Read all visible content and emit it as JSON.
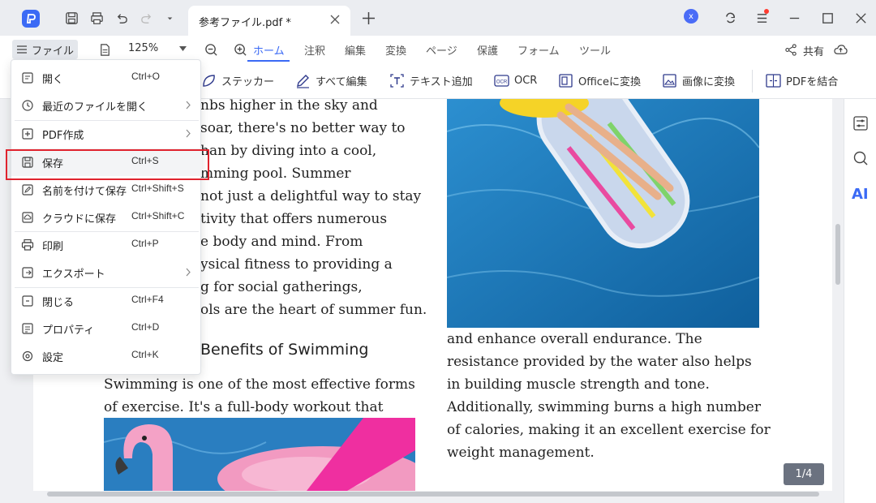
{
  "titlebar": {
    "tab_title": "参考ファイル.pdf *",
    "avatar_initial": "x"
  },
  "menubar": {
    "file_menu_label": "ファイル",
    "zoom": "125%",
    "tabs": [
      "ホーム",
      "注釈",
      "編集",
      "変換",
      "ページ",
      "保護",
      "フォーム",
      "ツール"
    ],
    "active_tab": "ホーム",
    "share_label": "共有"
  },
  "ribbon": {
    "items": [
      "ステッカー",
      "すべて編集",
      "テキスト追加",
      "OCR",
      "Officeに変換",
      "画像に変換",
      "PDFを結合"
    ]
  },
  "document": {
    "left_column_lines": [
      "nbs higher in the sky and",
      "soar, there's no better way to",
      "han by diving into a cool,",
      "mming pool. Summer",
      "not just a delightful way to stay",
      "tivity that offers numerous",
      "e body and mind. From",
      "ysical fitness to providing a",
      "g for social gatherings,",
      "ols are the heart of summer fun."
    ],
    "heading": "Benefits of Swimming",
    "left_para2_lines": [
      "Swimming is one of the most effective forms",
      "of exercise. It's a full-body workout that"
    ],
    "right_column_lines": [
      "and enhance overall endurance. The",
      "resistance provided by the water also helps",
      "in building muscle strength and tone.",
      "Additionally, swimming burns a high number",
      "of calories, making it an excellent exercise for",
      "weight management."
    ]
  },
  "page_counter": "1/4",
  "right_panel": {
    "ai_label": "AI"
  },
  "file_menu": {
    "items": [
      {
        "label": "開く",
        "shortcut": "Ctrl+O",
        "icon": "open-icon",
        "submenu": false
      },
      {
        "label": "最近のファイルを開く",
        "shortcut": "",
        "icon": "clock-icon",
        "submenu": true
      },
      {
        "label": "PDF作成",
        "shortcut": "",
        "icon": "pdf-create-icon",
        "submenu": true
      },
      {
        "label": "保存",
        "shortcut": "Ctrl+S",
        "icon": "save-icon",
        "submenu": false
      },
      {
        "label": "名前を付けて保存",
        "shortcut": "Ctrl+Shift+S",
        "icon": "save-as-icon",
        "submenu": false
      },
      {
        "label": "クラウドに保存",
        "shortcut": "Ctrl+Shift+C",
        "icon": "cloud-save-icon",
        "submenu": false
      },
      {
        "label": "印刷",
        "shortcut": "Ctrl+P",
        "icon": "print-icon",
        "submenu": false
      },
      {
        "label": "エクスポート",
        "shortcut": "",
        "icon": "export-icon",
        "submenu": true
      },
      {
        "label": "閉じる",
        "shortcut": "Ctrl+F4",
        "icon": "close-file-icon",
        "submenu": false
      },
      {
        "label": "プロパティ",
        "shortcut": "Ctrl+D",
        "icon": "properties-icon",
        "submenu": false
      },
      {
        "label": "設定",
        "shortcut": "Ctrl+K",
        "icon": "settings-icon",
        "submenu": false
      }
    ]
  },
  "colors": {
    "accent": "#3b6af5",
    "highlight_box": "#e0232e"
  }
}
